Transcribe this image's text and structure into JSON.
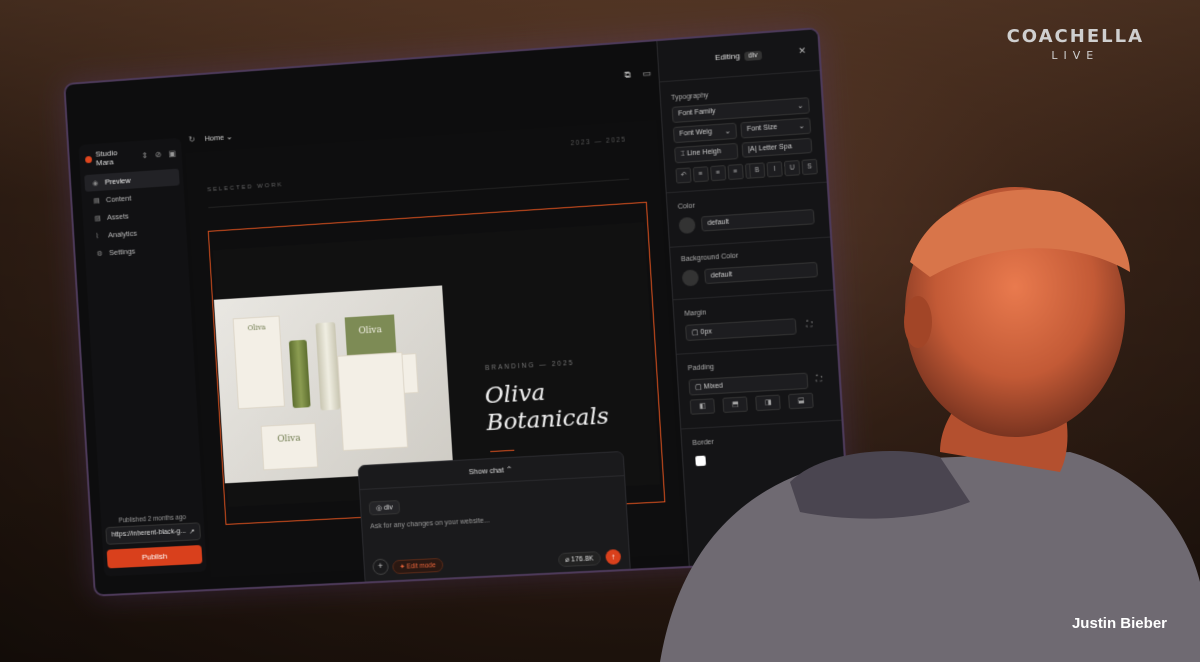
{
  "broadcast": {
    "logo_line1": "COACHELLA",
    "logo_line2": "LIVE",
    "caption": "Justin Bieber"
  },
  "sidebar": {
    "workspace": "Studio Mara",
    "items": [
      {
        "label": "Preview",
        "icon": "eye-icon",
        "active": true
      },
      {
        "label": "Content",
        "icon": "document-icon"
      },
      {
        "label": "Assets",
        "icon": "image-icon"
      },
      {
        "label": "Analytics",
        "icon": "chart-icon"
      },
      {
        "label": "Settings",
        "icon": "gear-icon"
      }
    ],
    "published": "Published 2 months ago",
    "url": "https://inherent-black-g...",
    "publish_label": "Publish"
  },
  "pagebar": {
    "page": "Home"
  },
  "canvas": {
    "section_label": "SELECTED WORK",
    "years": "2023 — 2025",
    "brand_meta": "BRANDING — 2025",
    "brand_title_1": "Oliva",
    "brand_title_2": "Botanicals",
    "card_text": "Oliva"
  },
  "chat": {
    "toggle_label": "Show chat",
    "selected_tag": "div",
    "placeholder": "Ask for any changes on your website...",
    "edit_mode_label": "Edit mode",
    "tokens": "176.8K"
  },
  "panel": {
    "title": "Editing",
    "element": "div",
    "typography_label": "Typography",
    "font_family": "Font Family",
    "font_weight": "Font Weig",
    "font_size": "Font Size",
    "line_height": "Line Heigh",
    "letter_spacing": "Letter Spa",
    "color_label": "Color",
    "color_value": "default",
    "bg_label": "Background Color",
    "bg_value": "default",
    "margin_label": "Margin",
    "margin_value": "0px",
    "padding_label": "Padding",
    "padding_value": "Mixed",
    "border_label": "Border"
  },
  "colors": {
    "accent": "#d9401c",
    "panel": "#141416",
    "canvas": "#0e0e0f"
  }
}
